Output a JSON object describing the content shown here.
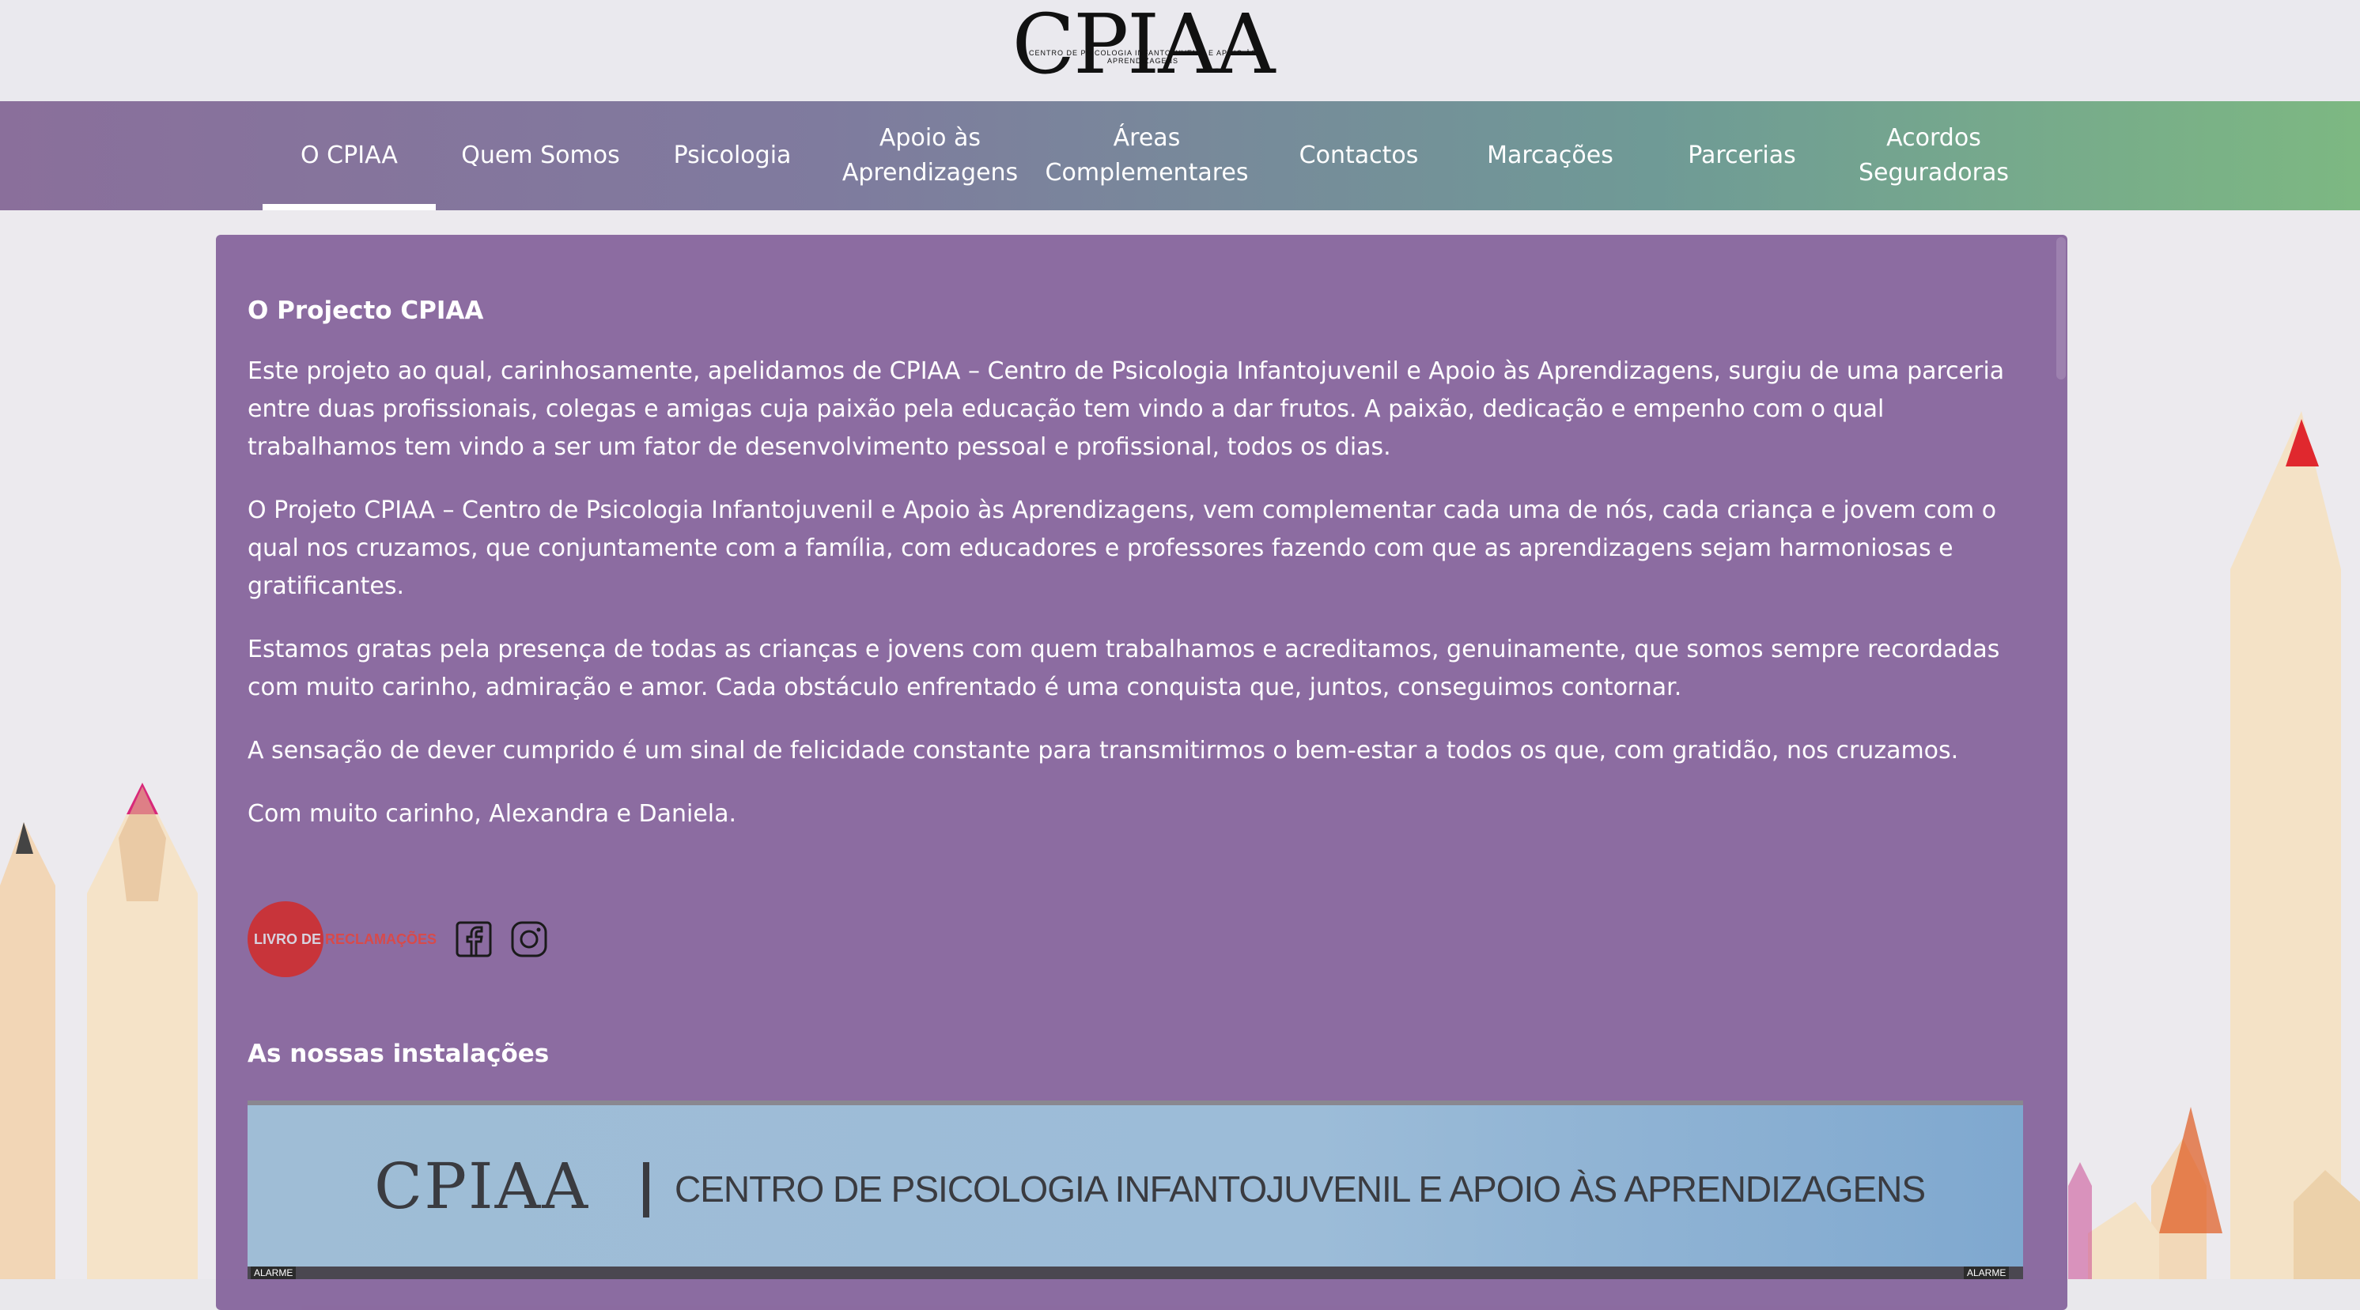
{
  "header": {
    "logo_text": "CPIAA",
    "logo_subtitle": "CENTRO DE PSICOLOGIA INFANTOJUVENIL E APOIO ÀS APRENDIZAGENS"
  },
  "nav": {
    "items": [
      {
        "label": "O CPIAA",
        "active": true
      },
      {
        "label": "Quem Somos"
      },
      {
        "label": "Psicologia"
      },
      {
        "label": "Apoio às Aprendizagens"
      },
      {
        "label": "Áreas Complementares"
      },
      {
        "label": "Contactos"
      },
      {
        "label": "Marcações"
      },
      {
        "label": "Parcerias"
      },
      {
        "label": "Acordos Seguradoras"
      }
    ]
  },
  "main": {
    "title": "O Projecto CPIAA",
    "paragraphs": [
      "Este projeto ao qual, carinhosamente, apelidamos de CPIAA – Centro de Psicologia Infantojuvenil e Apoio às Aprendizagens, surgiu de uma parceria entre duas profissionais, colegas e amigas cuja paixão pela educação tem vindo a dar frutos. A paixão, dedicação e empenho com o qual trabalhamos tem vindo a ser um fator de desenvolvimento pessoal e profissional, todos os dias.",
      "O Projeto CPIAA – Centro de Psicologia Infantojuvenil e Apoio às Aprendizagens, vem complementar cada uma de nós, cada criança e jovem com o qual nos cruzamos, que conjuntamente com a família, com educadores e professores fazendo com que as aprendizagens sejam harmoniosas e gratificantes.",
      "Estamos gratas pela presença de todas as crianças e jovens com quem trabalhamos e acreditamos, genuinamente, que somos sempre recordadas com muito carinho, admiração e amor. Cada obstáculo enfrentado é uma conquista que, juntos, conseguimos contornar.",
      "A sensação de dever cumprido é um sinal de felicidade constante para transmitirmos o bem-estar a todos os que, com gratidão, nos cruzamos.",
      "Com muito carinho, Alexandra e Daniela."
    ],
    "livro_reclamacoes": {
      "part1": "LIVRO DE",
      "part2": "RECLAMAÇÕES"
    },
    "social": [
      "facebook-icon",
      "instagram-icon"
    ],
    "facilities_title": "As nossas instalações",
    "sign": {
      "brand": "CPIAA",
      "full": "CENTRO DE PSICOLOGIA INFANTOJUVENIL E APOIO ÀS APRENDIZAGENS",
      "alarm_label": "ALARME"
    }
  },
  "colors": {
    "panel": "#7c5794",
    "nav_start": "#8a6f9b",
    "nav_end": "#7db882",
    "accent_red": "#c8343a"
  }
}
